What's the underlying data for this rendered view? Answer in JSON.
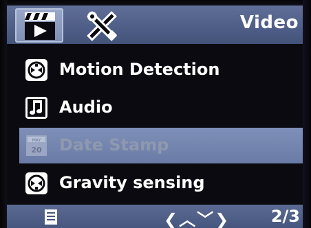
{
  "header": {
    "tabs": [
      {
        "icon": "video-clapper-icon",
        "active": true
      },
      {
        "icon": "tools-icon",
        "active": false
      }
    ],
    "title": "Video"
  },
  "menu": {
    "items": [
      {
        "label": "Motion Detection",
        "icon": "motion-detection-icon",
        "state": "normal"
      },
      {
        "label": "Audio",
        "icon": "music-note-icon",
        "state": "normal"
      },
      {
        "label": "Date Stamp",
        "icon": "calendar-icon",
        "state": "selected-disabled"
      },
      {
        "label": "Gravity sensing",
        "icon": "gravity-sensor-icon",
        "state": "normal"
      }
    ]
  },
  "footer": {
    "menu_icon": "menu-icon",
    "nav_arrows": "❮︿﹀❯",
    "page": "2/3"
  },
  "colors": {
    "bar": "#4d5d86",
    "selection": "#7585b0",
    "text": "#ffffff",
    "disabled_text": "#8e99b0"
  }
}
